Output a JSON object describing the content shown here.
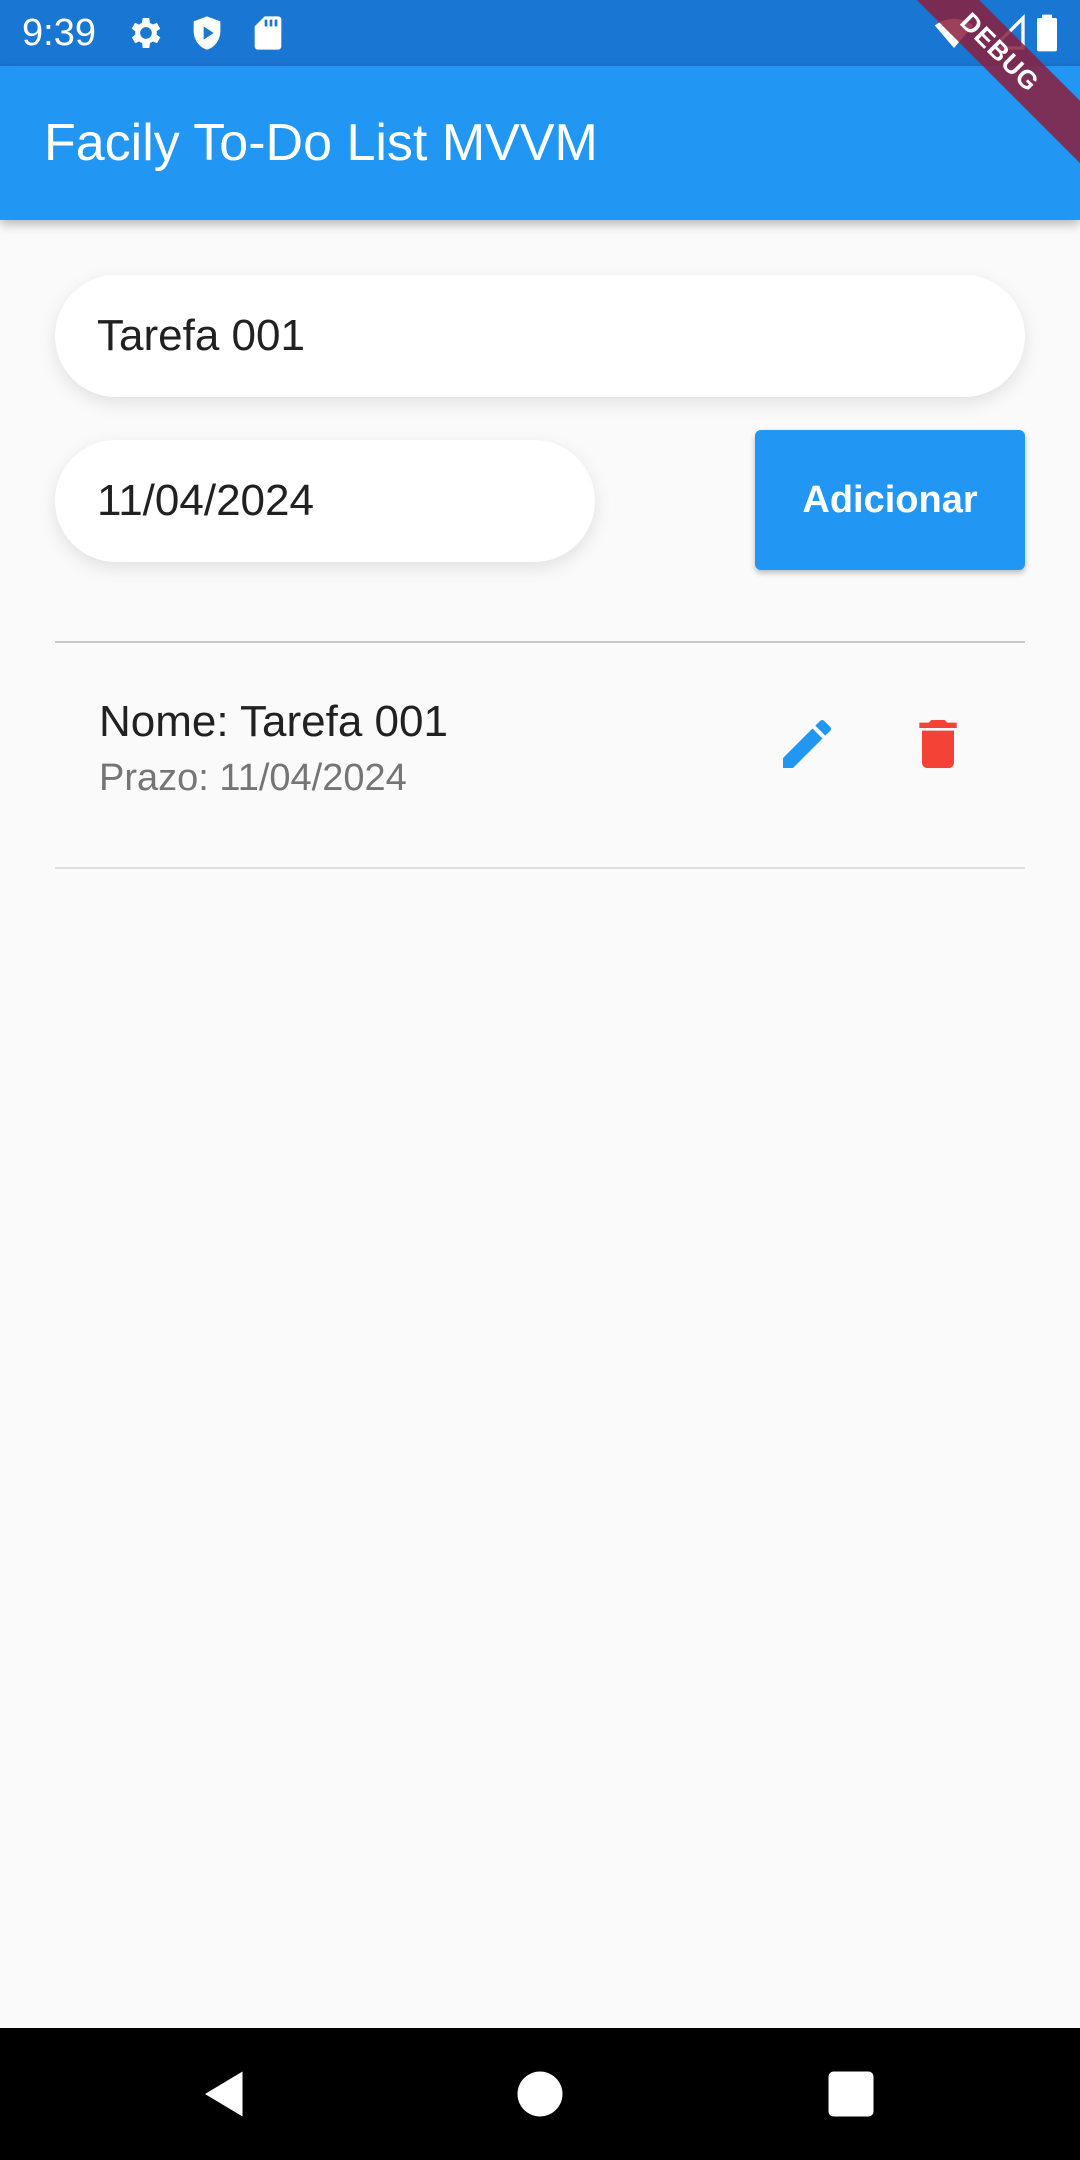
{
  "status_bar": {
    "time": "9:39",
    "icons_left": [
      "gear-icon",
      "shield-play-icon",
      "sd-card-icon"
    ],
    "icons_right": [
      "wifi-icon",
      "signal-icon",
      "battery-icon"
    ]
  },
  "debug_banner": "DEBUG",
  "app_bar": {
    "title": "Facily To-Do List MVVM",
    "color": "#2196f3"
  },
  "form": {
    "task_value": "Tarefa 001",
    "date_value": "11/04/2024",
    "add_label": "Adicionar"
  },
  "tasks": [
    {
      "name": "Nome: Tarefa 001",
      "deadline": "Prazo: 11/04/2024",
      "edit_icon": "pencil-icon",
      "delete_icon": "trash-icon"
    }
  ],
  "colors": {
    "accent": "#2196f3",
    "status_bar": "#1976d2",
    "delete": "#f44336"
  },
  "nav_bar": {
    "buttons": [
      "back-icon",
      "home-icon",
      "recents-icon"
    ]
  }
}
